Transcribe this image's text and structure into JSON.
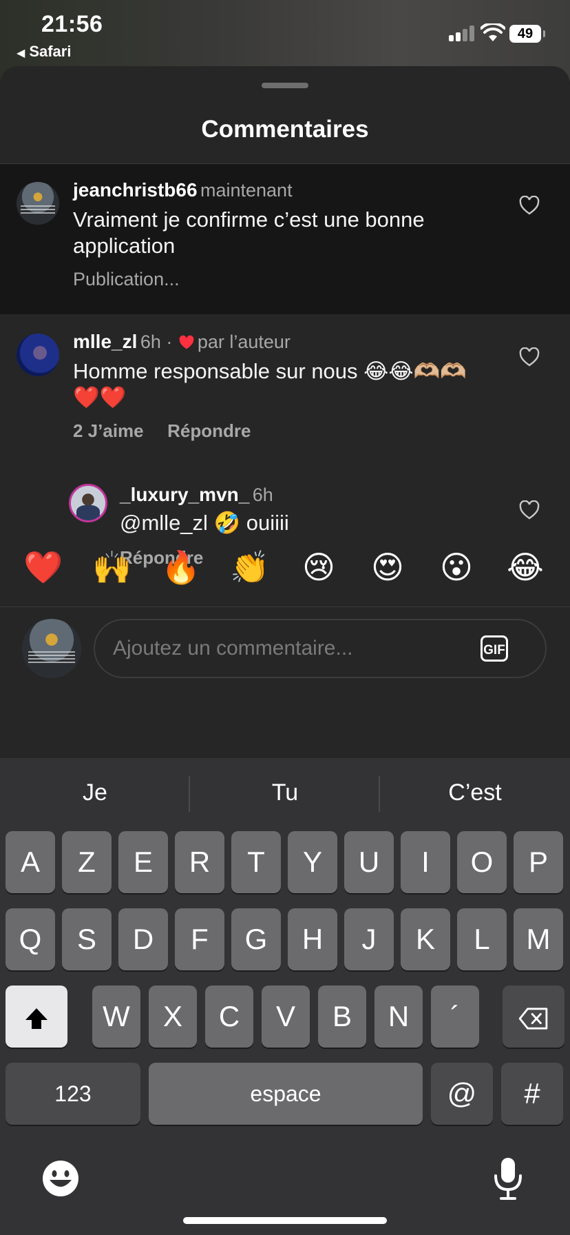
{
  "status_bar": {
    "time": "21:56",
    "back_app": "Safari",
    "battery": "49"
  },
  "sheet": {
    "title": "Commentaires"
  },
  "comments": [
    {
      "user": "jeanchristb66",
      "time": "maintenant",
      "text": "Vraiment je confirme c’est une bonne application",
      "status": "Publication..."
    },
    {
      "user": "mlle_zl",
      "time": "6h ·",
      "liked_by": "par l’auteur",
      "text": "Homme responsable sur nous 😂😂🫶🏼🫶🏼❤️❤️",
      "likes": "2 J’aime",
      "reply": "Répondre"
    },
    {
      "user": "_luxury_mvn_",
      "time": "6h",
      "text": "@mlle_zl 🤣 ouiiii",
      "reply": "Répondre"
    }
  ],
  "reactions": [
    "❤️",
    "🙌",
    "🔥",
    "👏",
    "😢",
    "😍",
    "😮",
    "😂"
  ],
  "composer": {
    "placeholder": "Ajoutez un commentaire...",
    "gif_label": "GIF"
  },
  "keyboard": {
    "suggestions": [
      "Je",
      "Tu",
      "C’est"
    ],
    "row1": [
      "A",
      "Z",
      "E",
      "R",
      "T",
      "Y",
      "U",
      "I",
      "O",
      "P"
    ],
    "row2": [
      "Q",
      "S",
      "D",
      "F",
      "G",
      "H",
      "J",
      "K",
      "L",
      "M"
    ],
    "row3": [
      "W",
      "X",
      "C",
      "V",
      "B",
      "N",
      "´"
    ],
    "numbers_key": "123",
    "space_key": "espace",
    "at_key": "@",
    "hash_key": "#"
  },
  "colors": {
    "background": "#262626",
    "highlight": "#161616",
    "heart_red": "#ff3040",
    "secondary_text": "#a8a8a8"
  }
}
